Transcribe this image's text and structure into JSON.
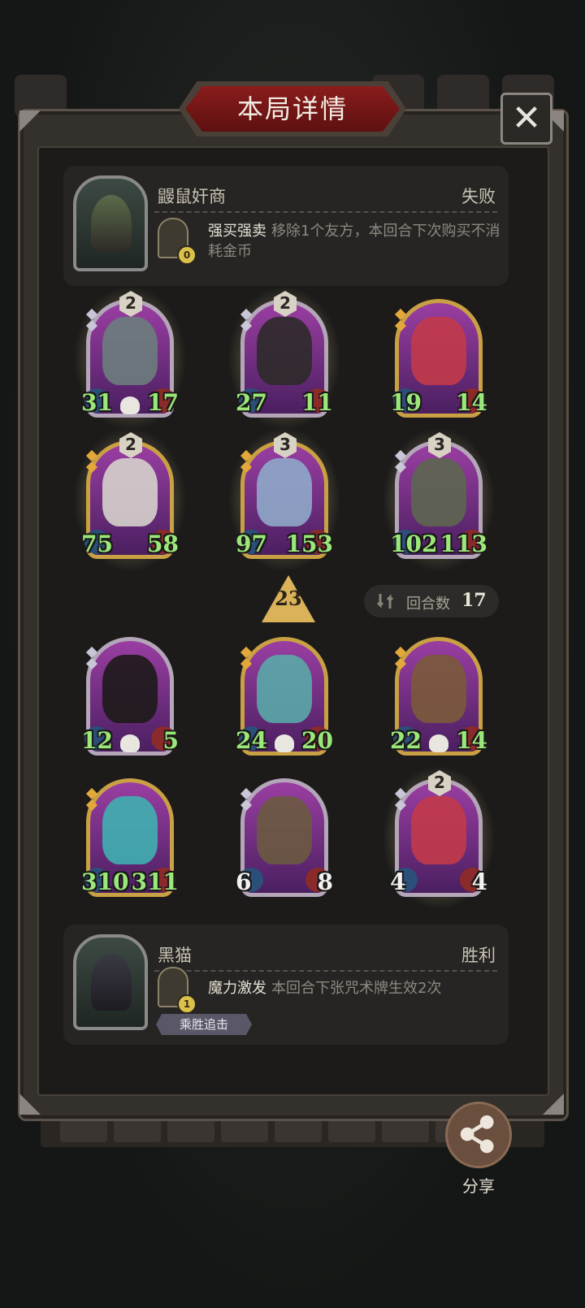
{
  "title": "本局详情",
  "close_label": "✕",
  "top_player": {
    "name": "鼹鼠奸商",
    "result": "失败",
    "skill_count": "0",
    "skill_name": "强买强卖",
    "skill_desc": "移除1个友方，本回合下次购买不消耗金币"
  },
  "bottom_player": {
    "name": "黑猫",
    "result": "胜利",
    "skill_count": "1",
    "skill_name": "魔力激发",
    "skill_desc": "本回合下张咒术牌生效2次",
    "tag": "乘胜追击"
  },
  "level_value": "23",
  "round": {
    "label": "回合数",
    "value": "17"
  },
  "top_cards": [
    {
      "level": "2",
      "atk": "31",
      "hp": "17",
      "gold": false,
      "skull": true
    },
    {
      "level": "2",
      "atk": "27",
      "hp": "11",
      "gold": false,
      "skull": false
    },
    {
      "level": "",
      "atk": "19",
      "hp": "14",
      "gold": true,
      "skull": false
    },
    {
      "level": "2",
      "atk": "75",
      "hp": "58",
      "gold": true,
      "skull": false
    },
    {
      "level": "3",
      "atk": "97",
      "hp": "153",
      "gold": true,
      "skull": false
    },
    {
      "level": "3",
      "atk": "102",
      "hp": "113",
      "gold": false,
      "skull": false
    }
  ],
  "bottom_cards": [
    {
      "level": "",
      "atk": "12",
      "hp": "5",
      "gold": false,
      "skull": true
    },
    {
      "level": "",
      "atk": "24",
      "hp": "20",
      "gold": true,
      "skull": true
    },
    {
      "level": "",
      "atk": "22",
      "hp": "14",
      "gold": true,
      "skull": true
    },
    {
      "level": "",
      "atk": "310",
      "hp": "311",
      "gold": true,
      "skull": false
    },
    {
      "level": "",
      "atk": "6",
      "hp": "8",
      "gold": false,
      "skull": false
    },
    {
      "level": "2",
      "atk": "4",
      "hp": "4",
      "gold": false,
      "skull": false
    }
  ],
  "share_label": "分享",
  "colors": {
    "accent_red": "#8a1c1c",
    "stat_green": "#9be87a",
    "panel_bg": "#262523"
  }
}
